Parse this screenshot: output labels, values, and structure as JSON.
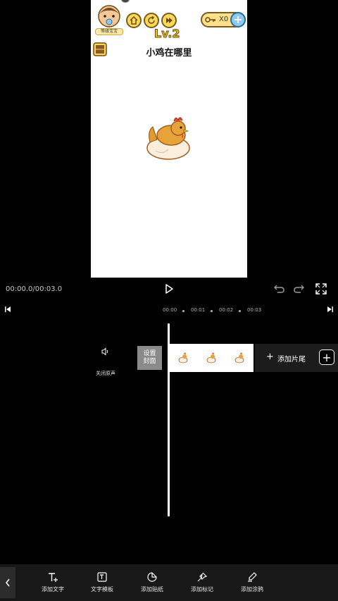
{
  "game": {
    "avatar_label": "等级宝宝",
    "level": "Lv.2",
    "keys_count": "X0",
    "plus": "+",
    "question": "小鸡在哪里"
  },
  "playback": {
    "time": "00:00.0/00:03.0"
  },
  "ruler": {
    "ticks": [
      "00:00",
      "00:01",
      "00:02",
      "00:03"
    ]
  },
  "track": {
    "mute_label": "关闭原声",
    "cover_label": "设置\n封面",
    "add_clip_plus": "+",
    "add_clip_label": "添加片尾",
    "add_media_plus": "+"
  },
  "toolbar": {
    "items": [
      {
        "label": "添加文字",
        "icon": "add-text-icon"
      },
      {
        "label": "文字模板",
        "icon": "text-template-icon"
      },
      {
        "label": "添加贴纸",
        "icon": "sticker-icon"
      },
      {
        "label": "添加标记",
        "icon": "marker-icon"
      },
      {
        "label": "添加涂鸦",
        "icon": "brush-icon"
      }
    ]
  },
  "colors": {
    "background": "#000000",
    "toolbar": "#181818",
    "cover_button": "#8a8a8a",
    "level_text": "#f2c318"
  }
}
